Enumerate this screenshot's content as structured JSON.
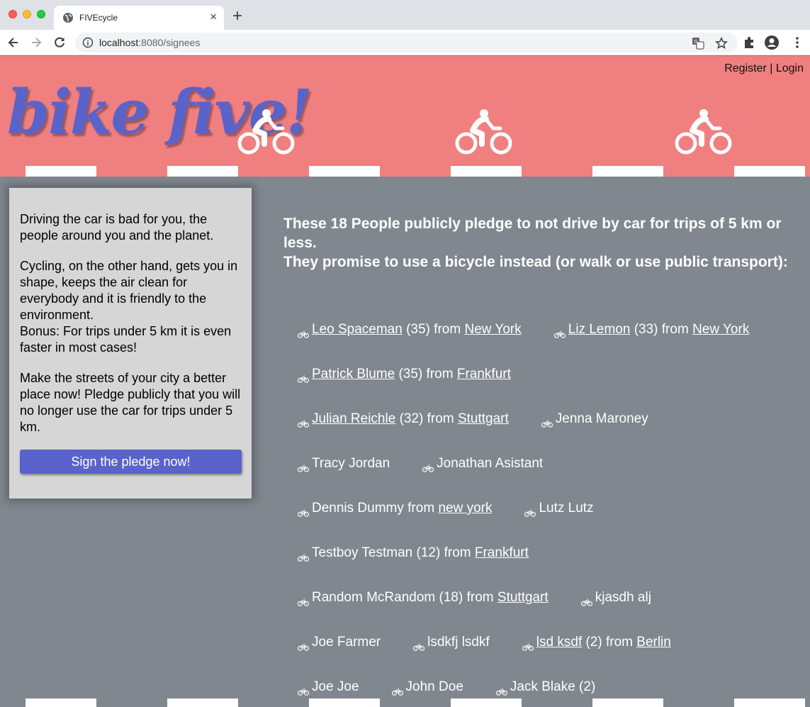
{
  "browser": {
    "tab_title": "FIVEcycle",
    "tab_close": "×",
    "new_tab": "+",
    "url_host": "localhost",
    "url_path": ":8080/signees"
  },
  "header": {
    "logo_text": "bike five!",
    "register": "Register",
    "separator": " | ",
    "login": "Login"
  },
  "sidebar": {
    "p1": "Driving the car is bad for you, the people around you and the planet.",
    "p2a": "Cycling, on the other hand, gets you in shape, keeps the air clean for everybody and it is friendly to the environment.",
    "p2b": "Bonus: For trips under 5 km it is even faster in most cases!",
    "p3": "Make the streets of your city a better place now! Pledge publicly that you will no longer use the car for trips under 5 km.",
    "cta": "Sign the pledge now!"
  },
  "main": {
    "headline_1": "These 18 People publicly pledge to not drive by car for trips of 5 km or less.",
    "headline_2": "They promise to use a bicycle instead (or walk or use public transport):",
    "rows": [
      [
        {
          "name": "Leo Spaceman",
          "name_link": true,
          "age": " (35)",
          "from": " from ",
          "city": "New York"
        },
        {
          "name": "Liz Lemon",
          "name_link": true,
          "age": " (33)",
          "from": " from ",
          "city": "New York"
        }
      ],
      [
        {
          "name": "Patrick Blume",
          "name_link": true,
          "age": " (35)",
          "from": " from ",
          "city": "Frankfurt"
        }
      ],
      [
        {
          "name": "Julian Reichle",
          "name_link": true,
          "age": " (32)",
          "from": " from ",
          "city": "Stuttgart"
        },
        {
          "name": "Jenna Maroney",
          "name_link": false,
          "age": "",
          "from": "",
          "city": ""
        }
      ],
      [
        {
          "name": "Tracy Jordan",
          "name_link": false,
          "age": "",
          "from": "",
          "city": ""
        },
        {
          "name": "Jonathan Asistant",
          "name_link": false,
          "age": "",
          "from": "",
          "city": ""
        }
      ],
      [
        {
          "name": "Dennis Dummy",
          "name_link": false,
          "age": "",
          "from": " from ",
          "city": "new york"
        },
        {
          "name": "Lutz Lutz",
          "name_link": false,
          "age": "",
          "from": "",
          "city": ""
        }
      ],
      [
        {
          "name": "Testboy Testman",
          "name_link": false,
          "age": " (12)",
          "from": " from ",
          "city": "Frankfurt"
        }
      ],
      [
        {
          "name": "Random McRandom",
          "name_link": false,
          "age": " (18)",
          "from": " from ",
          "city": "Stuttgart"
        },
        {
          "name": "kjasdh alj",
          "name_link": false,
          "age": "",
          "from": "",
          "city": ""
        }
      ],
      [
        {
          "name": "Joe Farmer",
          "name_link": false,
          "age": "",
          "from": "",
          "city": ""
        },
        {
          "name": "lsdkfj lsdkf",
          "name_link": false,
          "age": "",
          "from": "",
          "city": ""
        },
        {
          "name": "lsd ksdf",
          "name_link": true,
          "age": " (2)",
          "from": " from ",
          "city": "Berlin"
        }
      ],
      [
        {
          "name": "Joe Joe",
          "name_link": false,
          "age": "",
          "from": "",
          "city": ""
        },
        {
          "name": "John Doe",
          "name_link": false,
          "age": "",
          "from": "",
          "city": ""
        },
        {
          "name": "Jack Blake",
          "name_link": false,
          "age": " (2)",
          "from": "",
          "city": ""
        }
      ]
    ]
  },
  "colors": {
    "header_bg": "#f07f7f",
    "page_bg": "#80878e",
    "brand_blue": "#5a62cb",
    "card_bg": "#d6d6d6"
  }
}
